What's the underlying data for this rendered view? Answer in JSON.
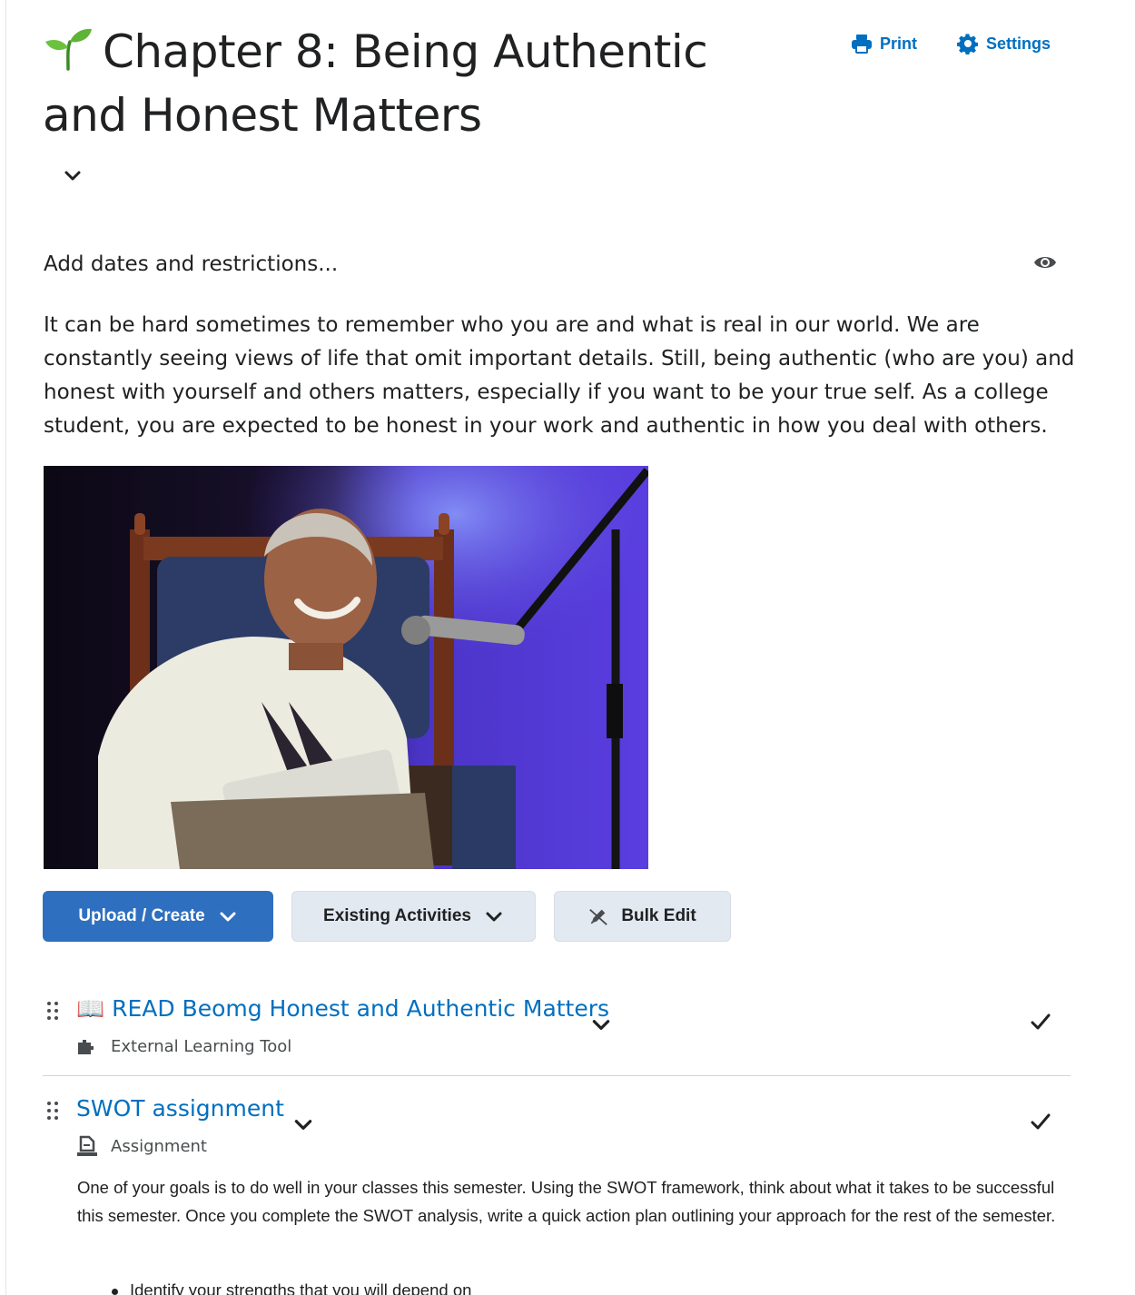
{
  "header": {
    "title": "Chapter 8: Being Authentic and Honest Matters",
    "print_label": "Print",
    "settings_label": "Settings"
  },
  "restrictions_label": "Add dates and restrictions...",
  "intro_text": "It can be hard sometimes to remember who you are and what is real in our world. We are constantly seeing views of life that omit important details. Still, being authentic (who are you) and honest with yourself and others matters, especially if you want to be your true self. As a college student, you are expected to be honest in your work and authentic in how you deal with others.",
  "toolbar": {
    "upload_label": "Upload / Create",
    "existing_label": "Existing Activities",
    "bulk_label": "Bulk Edit"
  },
  "items": [
    {
      "title": "📖 READ Beomg Honest and Authentic Matters",
      "type": "External Learning Tool"
    },
    {
      "title": "SWOT assignment",
      "type": "Assignment",
      "description": "One of your goals is to do well in your classes this semester.  Using the SWOT framework, think about what it takes to be successful this semester. Once you complete the SWOT analysis, write a quick action plan outlining your approach for the rest of the semester.",
      "bullets": [
        "Identify your strengths that you will depend on"
      ]
    }
  ],
  "colors": {
    "link": "#006fbf",
    "primary_button": "#2f6fbf",
    "secondary_button": "#e3e9f1"
  },
  "icons": {
    "title": "sprout-icon",
    "print": "printer-icon",
    "settings": "gear-icon",
    "visibility": "eye-icon",
    "drag": "drag-handle-icon",
    "lti": "puzzle-icon",
    "assignment": "assignment-icon",
    "complete": "checkmark-icon"
  }
}
